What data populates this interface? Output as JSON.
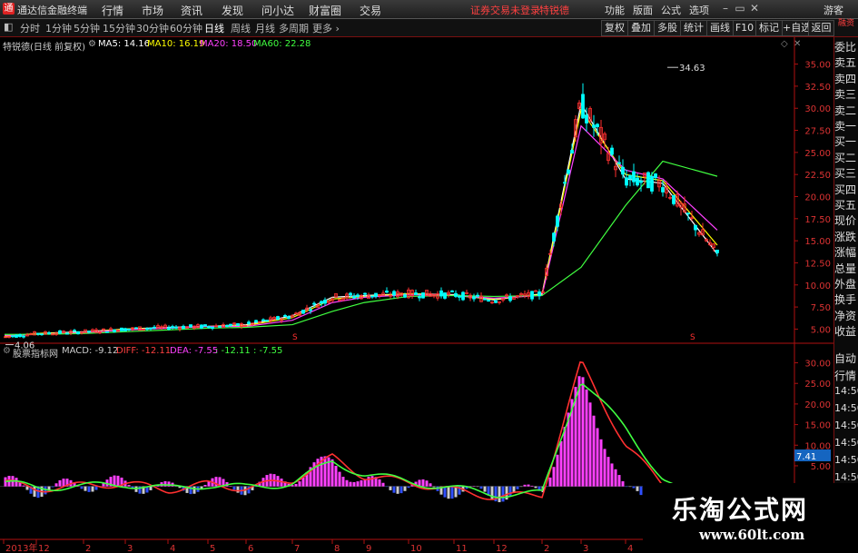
{
  "app": {
    "title": "通达信金融终端",
    "logo": "通"
  },
  "menu": [
    "行情",
    "市场",
    "资讯",
    "发现",
    "问小达",
    "财富圈",
    "交易"
  ],
  "status": {
    "login": "证券交易未登录",
    "stock": "特锐德"
  },
  "right_menu": [
    "功能",
    "版面",
    "公式",
    "选项",
    "游客"
  ],
  "tabs": [
    "分时",
    "1分钟",
    "5分钟",
    "15分钟",
    "30分钟",
    "60分钟",
    "日线",
    "周线",
    "月线",
    "多周期",
    "更多 ›"
  ],
  "active_tab": "日线",
  "toolbar_right": [
    "复权",
    "叠加",
    "多股",
    "统计",
    "画线",
    "F10",
    "标记",
    "+自选",
    "返回"
  ],
  "ma_line": {
    "name": "特锐德(日线 前复权)",
    "ma5": "MA5: 14.16",
    "ma10": "MA10: 16.19",
    "ma20": "MA20: 18.50",
    "ma60": "MA60: 22.28"
  },
  "macd_line": {
    "name": "股票指标网",
    "macd": "MACD: -9.12",
    "diff": "DIFF: -12.11",
    "dea": "DEA: -7.55",
    "extra": ": -12.11 : -7.55"
  },
  "price_axis": [
    "35.00",
    "32.50",
    "30.00",
    "27.50",
    "25.00",
    "22.50",
    "20.00",
    "17.50",
    "15.00",
    "12.50",
    "10.00",
    "7.50",
    "5.00"
  ],
  "macd_axis": [
    "30.00",
    "25.00",
    "20.00",
    "15.00",
    "10.00",
    "5.00"
  ],
  "macd_marker": "7.41",
  "x_axis": [
    "2013年",
    "12",
    "2",
    "3",
    "4",
    "5",
    "6",
    "7",
    "8",
    "9",
    "10",
    "11",
    "12",
    "2",
    "3",
    "4",
    "5"
  ],
  "annotations": {
    "high": "34.63",
    "low": "4.06"
  },
  "side_panel": [
    "委比",
    "卖五",
    "卖四",
    "卖三",
    "卖二",
    "卖一",
    "买一",
    "买二",
    "买三",
    "买四",
    "买五",
    "现价",
    "涨跌",
    "涨幅",
    "总量",
    "外盘",
    "换手",
    "净资",
    "收益"
  ],
  "side_panel2": [
    "自动",
    "行情",
    "14:50",
    "14:50",
    "14:50",
    "14:50",
    "14:50",
    "14:50",
    "14:50",
    "14:50",
    "14:50"
  ],
  "corner_tag": "融资",
  "watermark": {
    "title": "乐淘公式网",
    "url": "www.60lt.com"
  },
  "colors": {
    "ma5": "#ffffff",
    "ma10": "#ffff00",
    "ma20": "#ff40ff",
    "ma60": "#40ff40",
    "up": "#ff3030",
    "down": "#00ffff",
    "axis": "#b01010"
  },
  "chart_data": [
    {
      "type": "line",
      "title": "特锐德(日线 前复权)",
      "ylim": [
        3.5,
        36.5
      ],
      "x": [
        "2013-11",
        "2013-12",
        "2014-02",
        "2014-03",
        "2014-04",
        "2014-05",
        "2014-06",
        "2014-07",
        "2014-08",
        "2014-09",
        "2014-10",
        "2014-11",
        "2014-12",
        "2015-02",
        "2015-03",
        "2015-04",
        "2015-05",
        "2015-06"
      ],
      "series": [
        {
          "name": "MA5",
          "values": [
            4.1,
            4.5,
            4.7,
            5.0,
            5.2,
            5.3,
            5.5,
            6.5,
            8.6,
            8.8,
            9.0,
            8.9,
            8.3,
            9.0,
            30.5,
            22.0,
            21.5,
            13.5
          ]
        },
        {
          "name": "MA10",
          "values": [
            4.2,
            4.5,
            4.6,
            5.0,
            5.1,
            5.3,
            5.4,
            6.3,
            8.4,
            8.7,
            9.0,
            8.8,
            8.4,
            8.9,
            29.8,
            22.5,
            21.8,
            14.5
          ]
        },
        {
          "name": "MA20",
          "values": [
            4.3,
            4.4,
            4.6,
            4.9,
            5.1,
            5.3,
            5.3,
            6.0,
            8.0,
            8.6,
            8.9,
            8.8,
            8.5,
            8.8,
            28.0,
            23.0,
            22.0,
            16.2
          ]
        },
        {
          "name": "MA60",
          "values": [
            4.4,
            4.4,
            4.5,
            4.7,
            4.9,
            5.1,
            5.2,
            5.5,
            7.0,
            8.0,
            8.7,
            8.8,
            8.7,
            8.8,
            12.0,
            19.0,
            24.0,
            22.3
          ]
        }
      ],
      "high": 34.63,
      "low": 4.06
    },
    {
      "type": "bar",
      "title": "MACD",
      "ylim": [
        -10,
        31
      ],
      "series": [
        {
          "name": "DIFF",
          "values": [
            1.0,
            -0.6,
            0.2,
            0.7,
            -0.8,
            0.5,
            -0.4,
            1.5,
            7.0,
            2.5,
            1.0,
            -1.0,
            -2.5,
            -2.0,
            30.0,
            10.0,
            0.5,
            -12.11
          ]
        },
        {
          "name": "DEA",
          "values": [
            0.8,
            -0.2,
            0.0,
            0.6,
            -0.6,
            0.4,
            -0.3,
            0.8,
            6.0,
            3.0,
            1.2,
            -0.5,
            -1.8,
            -1.8,
            26.0,
            14.0,
            2.0,
            -7.55
          ]
        }
      ]
    }
  ]
}
